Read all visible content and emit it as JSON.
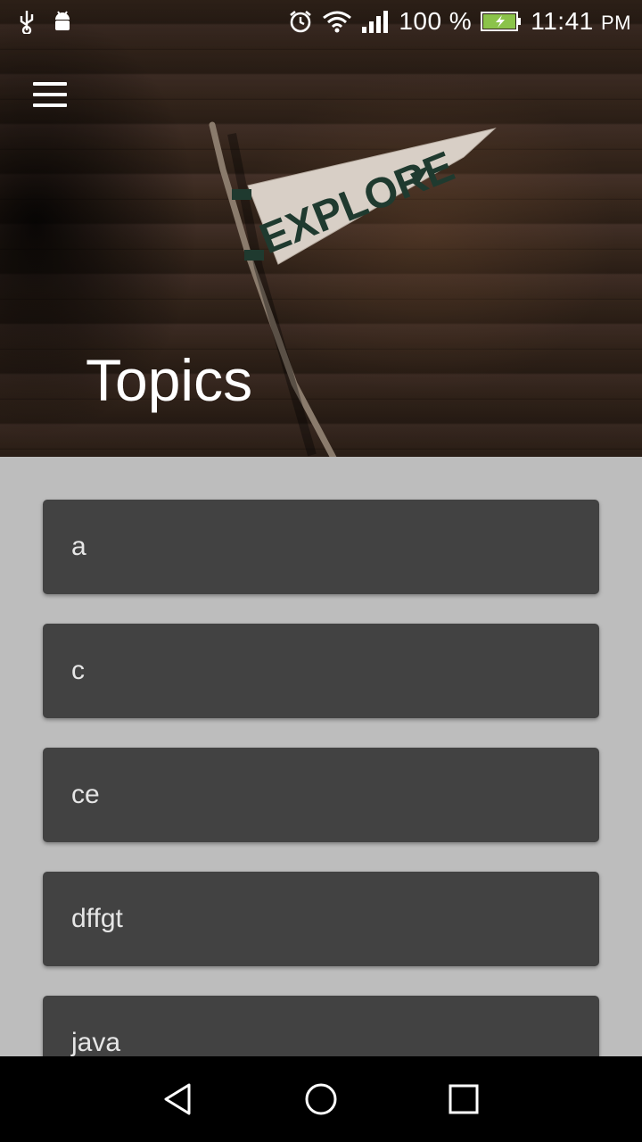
{
  "status_bar": {
    "battery_percent": "100 %",
    "time": "11:41",
    "time_suffix": "PM",
    "battery_color": "#8bc34a",
    "icons": [
      "usb-icon",
      "android-debug-icon",
      "alarm-icon",
      "wifi-icon",
      "signal-icon",
      "battery-icon"
    ]
  },
  "header": {
    "title": "Topics",
    "pennant_text": "EXPLORE",
    "menu_icon": "hamburger-menu-icon"
  },
  "topics": [
    {
      "label": "a"
    },
    {
      "label": "c"
    },
    {
      "label": "ce"
    },
    {
      "label": "dffgt"
    },
    {
      "label": "java"
    }
  ],
  "nav_bar": {
    "icons": [
      "back-icon",
      "home-icon",
      "recents-icon"
    ]
  },
  "colors": {
    "list_background": "#bdbdbd",
    "card_background": "#424242",
    "card_text": "#e6e6e6"
  }
}
